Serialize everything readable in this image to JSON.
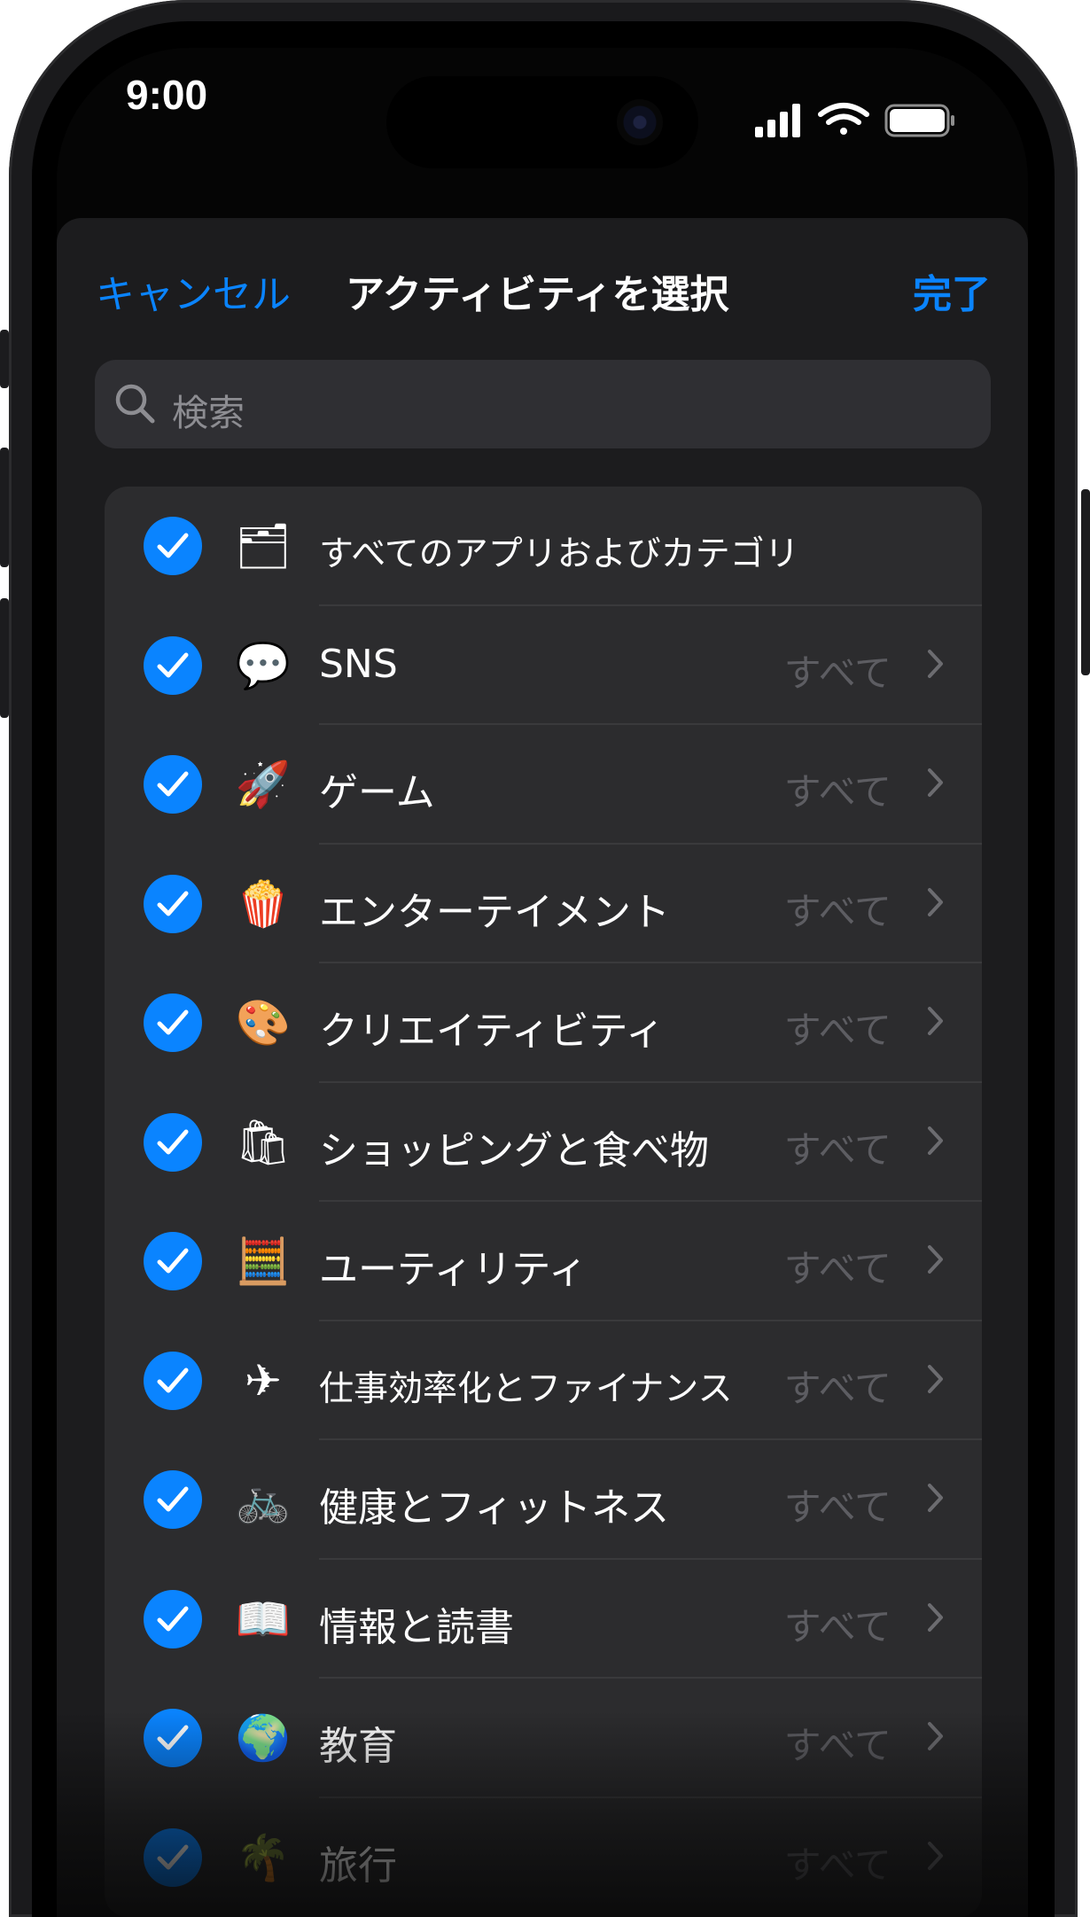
{
  "status_bar": {
    "time": "9:00",
    "icons": [
      "signal-icon",
      "wifi-icon",
      "battery-icon"
    ]
  },
  "nav": {
    "cancel": "キャンセル",
    "title": "アクティビティを選択",
    "done": "完了"
  },
  "search": {
    "placeholder": "検索"
  },
  "colors": {
    "accent": "#0a84ff",
    "background": "#1c1c1e",
    "cell": "#2c2c2e"
  },
  "categories": [
    {
      "label": "すべてのアプリおよびカテゴリ",
      "icon": "stack-icon",
      "emoji": "🗂",
      "detail": "",
      "checked": true
    },
    {
      "label": "SNS",
      "icon": "chat-bubbles-icon",
      "emoji": "💬",
      "detail": "すべて",
      "checked": true
    },
    {
      "label": "ゲーム",
      "icon": "rocket-icon",
      "emoji": "🚀",
      "detail": "すべて",
      "checked": true
    },
    {
      "label": "エンターテイメント",
      "icon": "popcorn-icon",
      "emoji": "🍿",
      "detail": "すべて",
      "checked": true
    },
    {
      "label": "クリエイティビティ",
      "icon": "palette-icon",
      "emoji": "🎨",
      "detail": "すべて",
      "checked": true
    },
    {
      "label": "ショッピングと食べ物",
      "icon": "shopping-bag-icon",
      "emoji": "🛍",
      "detail": "すべて",
      "checked": true
    },
    {
      "label": "ユーティリティ",
      "icon": "calculator-icon",
      "emoji": "🧮",
      "detail": "すべて",
      "checked": true
    },
    {
      "label": "仕事効率化とファイナンス",
      "icon": "paper-plane-icon",
      "emoji": "✈",
      "detail": "すべて",
      "checked": true
    },
    {
      "label": "健康とフィットネス",
      "icon": "bicycle-icon",
      "emoji": "🚲",
      "detail": "すべて",
      "checked": true
    },
    {
      "label": "情報と読書",
      "icon": "book-icon",
      "emoji": "📖",
      "detail": "すべて",
      "checked": true
    },
    {
      "label": "教育",
      "icon": "globe-icon",
      "emoji": "🌍",
      "detail": "すべて",
      "checked": true
    },
    {
      "label": "旅行",
      "icon": "palm-tree-icon",
      "emoji": "🌴",
      "detail": "すべて",
      "checked": true
    }
  ]
}
